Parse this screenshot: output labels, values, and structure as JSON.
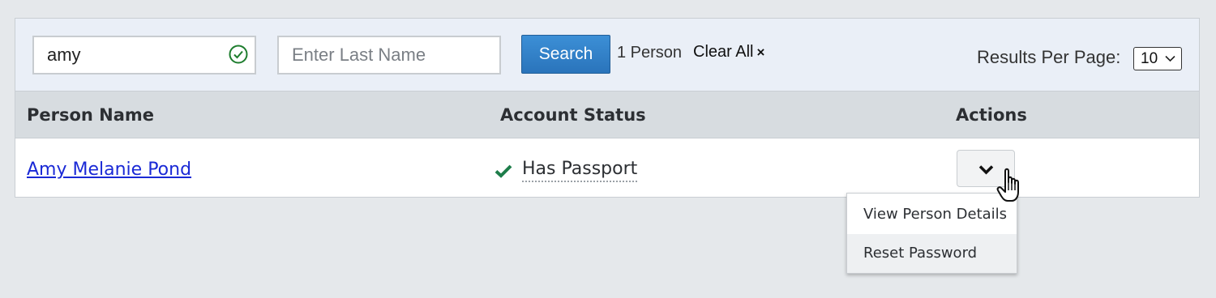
{
  "search": {
    "first_name_value": "amy",
    "last_name_placeholder": "Enter Last Name",
    "search_button_label": "Search",
    "result_count": "1 Person",
    "clear_all_label": "Clear All",
    "clear_all_icon": "×",
    "results_per_page_label": "Results Per Page:",
    "results_per_page_value": "10"
  },
  "table": {
    "headers": [
      "Person Name",
      "Account Status",
      "Actions"
    ],
    "rows": [
      {
        "name": "Amy Melanie Pond",
        "status": "Has Passport"
      }
    ]
  },
  "actions_menu": {
    "items": [
      "View Person Details",
      "Reset Password"
    ]
  },
  "icons": {
    "valid_input": "check-circle-icon",
    "status": "checkmark-icon",
    "actions_toggle": "chevron-down-icon",
    "cursor": "hand-pointer-icon"
  },
  "colors": {
    "search_bar_bg": "#eaeff7",
    "primary_button": "#2a74bb",
    "link": "#1a29d6",
    "success_green": "#1e7d4a",
    "header_bg": "#d7dce0"
  }
}
